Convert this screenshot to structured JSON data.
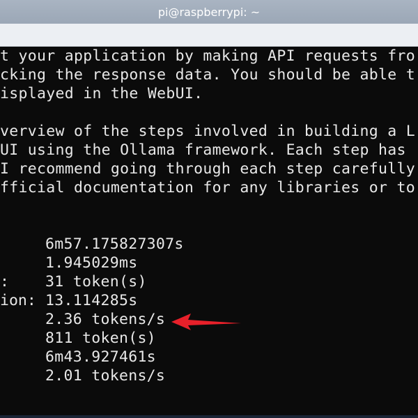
{
  "window": {
    "title": "pi@raspberrypi: ~"
  },
  "terminal": {
    "lines": [
      "t your application by making API requests fro",
      "cking the response data. You should be able t",
      "isplayed in the WebUI.",
      "",
      "verview of the steps involved in building a L",
      "UI using the Ollama framework. Each step has ",
      "I recommend going through each step carefully",
      "fficial documentation for any libraries or to"
    ],
    "stats": [
      {
        "label": "",
        "value": "6m57.175827307s"
      },
      {
        "label": "",
        "value": "1.945029ms"
      },
      {
        "label": ":",
        "value": "31 token(s)"
      },
      {
        "label": "ion:",
        "value": "13.114285s"
      },
      {
        "label": "",
        "value": "2.36 tokens/s"
      },
      {
        "label": "",
        "value": "811 token(s)"
      },
      {
        "label": "",
        "value": "6m43.927461s"
      },
      {
        "label": "",
        "value": "2.01 tokens/s"
      }
    ]
  },
  "annotation": {
    "arrow_color": "#e8202a",
    "arrow_icon": "left-arrow-icon"
  },
  "colors": {
    "terminal_bg": "#0b0b0b",
    "terminal_fg": "#e8e8e8",
    "titlebar_bg": "#a9b4c2",
    "titlebar_fg": "#ffffff"
  }
}
